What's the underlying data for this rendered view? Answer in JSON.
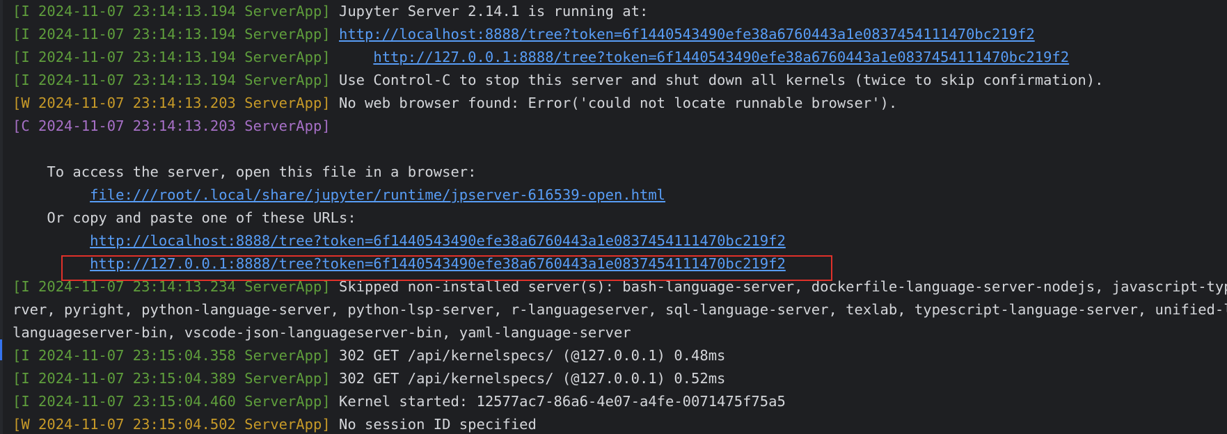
{
  "colors": {
    "background": "#1e1f22",
    "text": "#d4d6da",
    "info_prefix": "#5f9e3c",
    "warn_prefix": "#c79a28",
    "critical_prefix": "#a770c7",
    "link": "#589df6",
    "highlight_box": "#e0312a"
  },
  "log": {
    "l1": {
      "prefix": "[I 2024-11-07 23:14:13.194 ServerApp]",
      "text": " Jupyter Server 2.14.1 is running at:"
    },
    "l2": {
      "prefix": "[I 2024-11-07 23:14:13.194 ServerApp]",
      "sep": " ",
      "url": "http://localhost:8888/tree?token=6f1440543490efe38a6760443a1e0837454111470bc219f2"
    },
    "l3": {
      "prefix": "[I 2024-11-07 23:14:13.194 ServerApp]",
      "sep": "     ",
      "url": "http://127.0.0.1:8888/tree?token=6f1440543490efe38a6760443a1e0837454111470bc219f2"
    },
    "l4": {
      "prefix": "[I 2024-11-07 23:14:13.194 ServerApp]",
      "text": " Use Control-C to stop this server and shut down all kernels (twice to skip confirmation)."
    },
    "l5": {
      "prefix": "[W 2024-11-07 23:14:13.203 ServerApp]",
      "text": " No web browser found: Error('could not locate runnable browser')."
    },
    "l6": {
      "prefix": "[C 2024-11-07 23:14:13.203 ServerApp]"
    },
    "l8": {
      "text": "    To access the server, open this file in a browser:"
    },
    "l9": {
      "indent": "         ",
      "url": "file:///root/.local/share/jupyter/runtime/jpserver-616539-open.html"
    },
    "l10": {
      "text": "    Or copy and paste one of these URLs:"
    },
    "l11": {
      "indent": "         ",
      "url": "http://localhost:8888/tree?token=6f1440543490efe38a6760443a1e0837454111470bc219f2"
    },
    "l12": {
      "indent": "         ",
      "url": "http://127.0.0.1:8888/tree?token=6f1440543490efe38a6760443a1e0837454111470bc219f2"
    },
    "l13": {
      "prefix": "[I 2024-11-07 23:14:13.234 ServerApp]",
      "text": " Skipped non-installed server(s): bash-language-server, dockerfile-language-server-nodejs, javascript-typescript-langserver, jedi-language-server, julia-language-server, pyright, python-language-server, python-lsp-server, r-languageserver, sql-language-server, texlab, typescript-language-server, unified-language-server, vscode-css-languageserver-bin, vscode-html-languageserver-bin, vscode-json-languageserver-bin, yaml-language-server"
    },
    "l14": {
      "text": "rver, pyright, python-language-server, python-lsp-server, r-languageserver, sql-language-server, texlab, typescript-language-server, unified-langu"
    },
    "l15": {
      "text": "languageserver-bin, vscode-json-languageserver-bin, yaml-language-server"
    },
    "l16": {
      "prefix": "[I 2024-11-07 23:15:04.358 ServerApp]",
      "text": " 302 GET /api/kernelspecs/ (@127.0.0.1) 0.48ms"
    },
    "l17": {
      "prefix": "[I 2024-11-07 23:15:04.389 ServerApp]",
      "text": " 302 GET /api/kernelspecs/ (@127.0.0.1) 0.52ms"
    },
    "l18": {
      "prefix": "[I 2024-11-07 23:15:04.460 ServerApp]",
      "text": " Kernel started: 12577ac7-86a6-4e07-a4fe-0071475f75a5"
    },
    "l19": {
      "prefix": "[W 2024-11-07 23:15:04.502 ServerApp]",
      "text": " No session ID specified"
    }
  }
}
